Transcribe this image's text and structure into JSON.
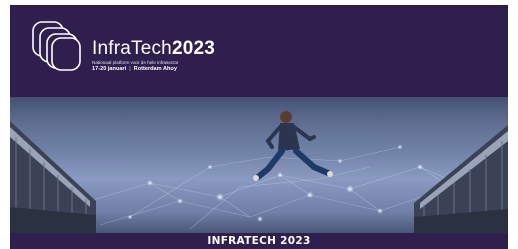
{
  "brand": {
    "name_light": "InfraTech",
    "name_bold": "2023",
    "tagline": "Nationaal platform voor de hele infrasector",
    "dates": "17-20 januari",
    "separator": "|",
    "venue": "Rotterdam Ahoy"
  },
  "logo_icon": "stacked-rounded-squares-icon",
  "hero": {
    "image_subject": "running-man-between-bridges"
  },
  "caption": {
    "text": "INFRATECH 2023"
  },
  "colors": {
    "brand_purple": "#2e1f4f",
    "sky_blue": "#8a9ac0"
  }
}
